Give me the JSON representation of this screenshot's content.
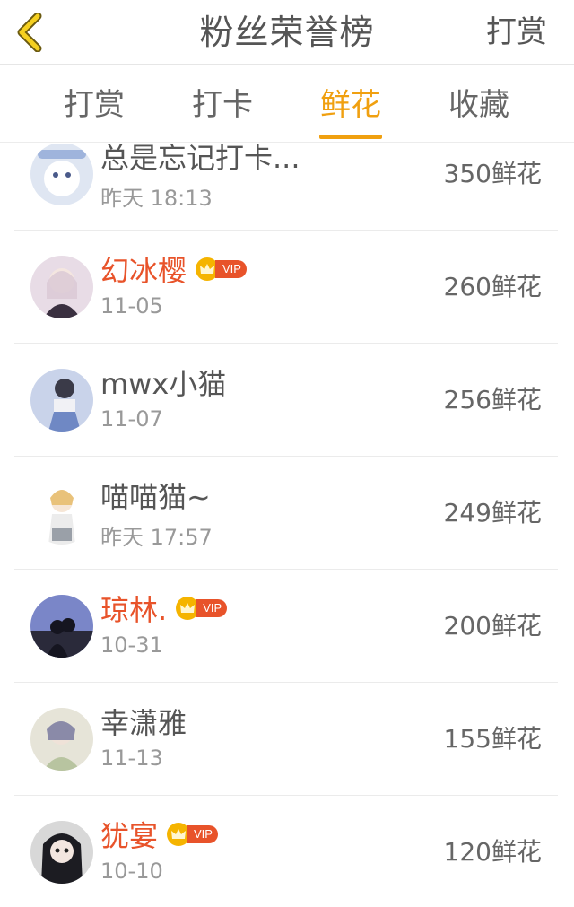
{
  "header": {
    "title": "粉丝荣誉榜",
    "right_action": "打赏"
  },
  "tabs": [
    {
      "label": "打赏",
      "active": false
    },
    {
      "label": "打卡",
      "active": false
    },
    {
      "label": "鲜花",
      "active": true
    },
    {
      "label": "收藏",
      "active": false
    }
  ],
  "rows": [
    {
      "name": "总是忘记打卡...",
      "vip": false,
      "time": "昨天 18:13",
      "count": "350鲜花"
    },
    {
      "name": "幻冰樱",
      "vip": true,
      "vip_label": "VIP",
      "time": "11-05",
      "count": "260鲜花"
    },
    {
      "name": "mwx小猫",
      "vip": false,
      "time": "11-07",
      "count": "256鲜花"
    },
    {
      "name": "喵喵猫~",
      "vip": false,
      "time": "昨天 17:57",
      "count": "249鲜花"
    },
    {
      "name": "琼林.",
      "vip": true,
      "vip_label": "VIP",
      "time": "10-31",
      "count": "200鲜花"
    },
    {
      "name": "幸潇雅",
      "vip": false,
      "time": "11-13",
      "count": "155鲜花"
    },
    {
      "name": "犹宴",
      "vip": true,
      "vip_label": "VIP",
      "time": "10-10",
      "count": "120鲜花"
    }
  ],
  "colors": {
    "accent": "#f0a010",
    "vip_name": "#e8532a",
    "vip_crown": "#f5b400"
  }
}
